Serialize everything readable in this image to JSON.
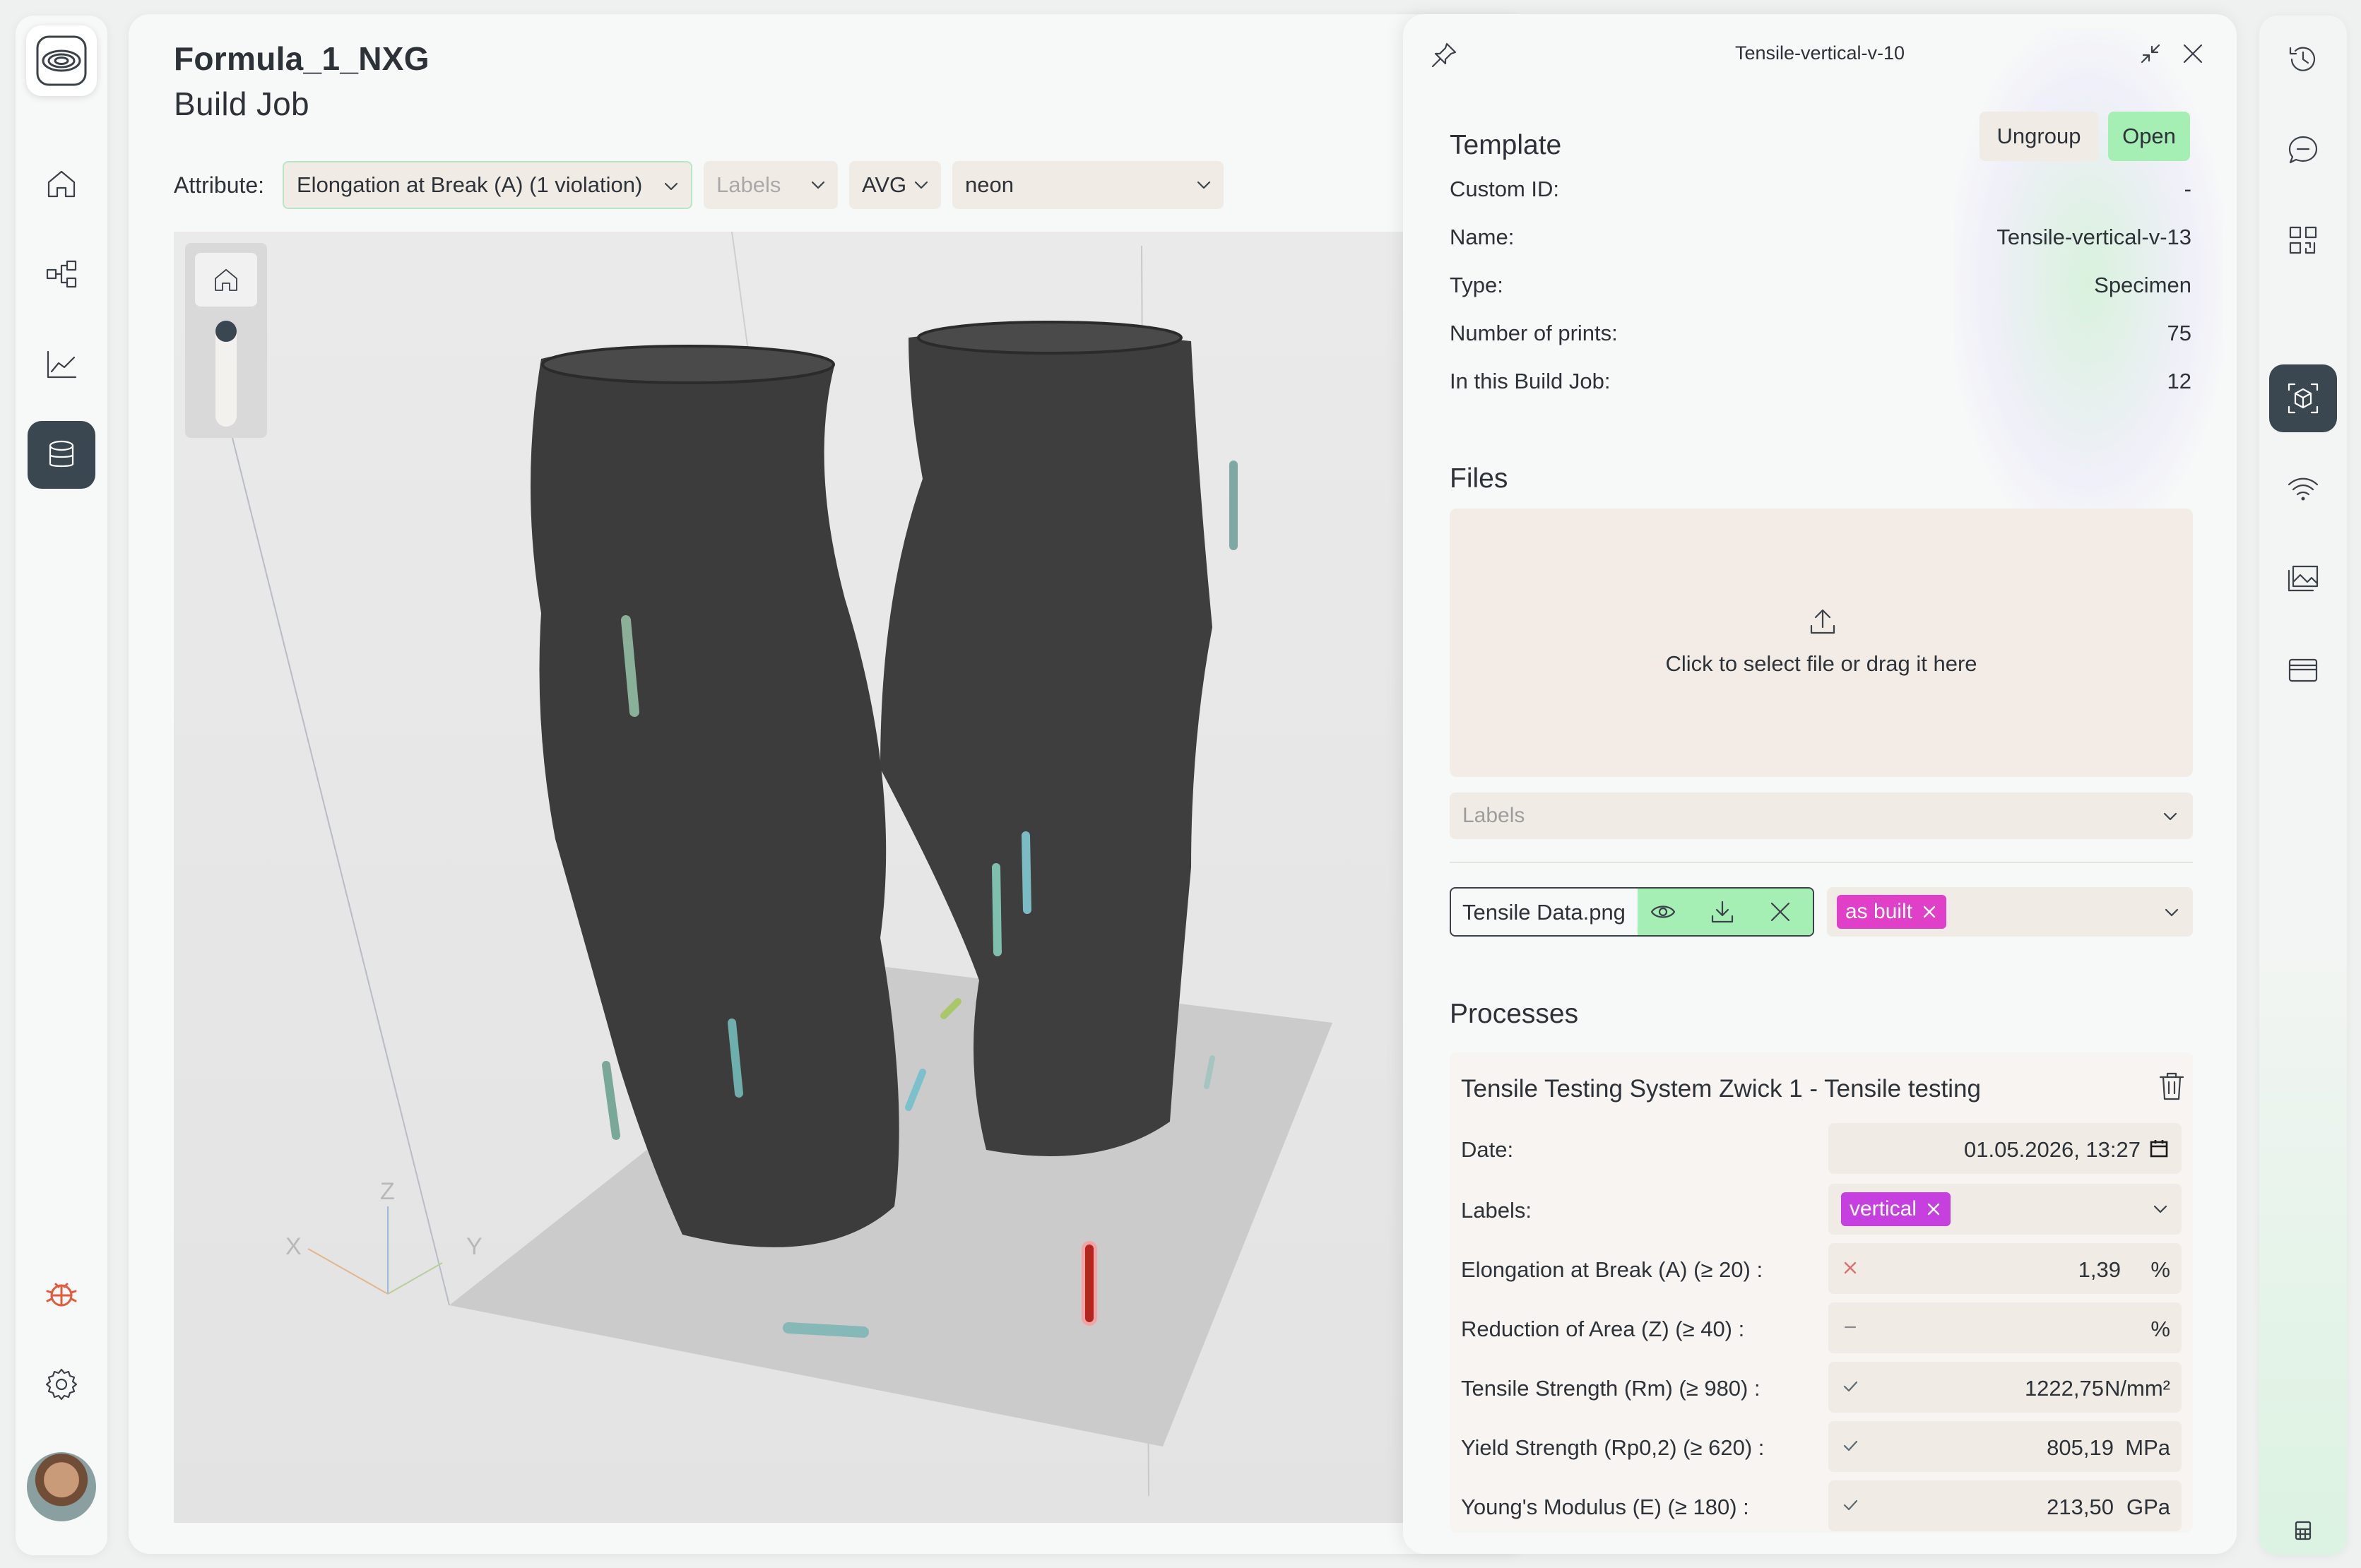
{
  "colors": {
    "accent_green": "#a5efb5",
    "tag_magenta": "#e040c8",
    "dark": "#3a4650",
    "violation_red": "#e07070",
    "field_bg": "#f1ebe5"
  },
  "left_nav": {
    "items": [
      {
        "icon": "home-icon"
      },
      {
        "icon": "workflow-icon"
      },
      {
        "icon": "chart-icon"
      },
      {
        "icon": "database-icon",
        "active": true
      }
    ],
    "bottom": [
      {
        "icon": "bug-icon"
      },
      {
        "icon": "gear-icon"
      },
      {
        "icon": "avatar"
      }
    ]
  },
  "header": {
    "title_line1": "Formula_1_NXG",
    "title_line2": "Build Job"
  },
  "toolbar": {
    "attribute_label": "Attribute:",
    "attribute_value": "Elongation at Break (A) (1 violation)",
    "labels_placeholder": "Labels",
    "aggregate_value": "AVG",
    "colormap_value": "neon"
  },
  "viewport": {
    "axes": {
      "x": "X",
      "y": "Y",
      "z": "Z"
    }
  },
  "detail": {
    "title": "Tensile-vertical-v-10",
    "template": {
      "heading": "Template",
      "ungroup_label": "Ungroup",
      "open_label": "Open",
      "fields": [
        {
          "key": "Custom ID:",
          "value": "-"
        },
        {
          "key": "Name:",
          "value": "Tensile-vertical-v-13"
        },
        {
          "key": "Type:",
          "value": "Specimen"
        },
        {
          "key": "Number of prints:",
          "value": "75"
        },
        {
          "key": "In this Build Job:",
          "value": "12"
        }
      ]
    },
    "files": {
      "heading": "Files",
      "dropzone_text": "Click to select file or drag it here",
      "labels_placeholder": "Labels",
      "file_name": "Tensile Data.png",
      "file_tag": "as built"
    },
    "processes": {
      "heading": "Processes",
      "card_title": "Tensile Testing System Zwick 1 - Tensile testing",
      "date_label": "Date:",
      "date_value": "01.05.2026, 13:27",
      "labels_label": "Labels:",
      "labels_tag": "vertical",
      "measurements": [
        {
          "label": "Elongation at Break (A)  (≥ 20) :",
          "status": "fail",
          "value": "1,39",
          "unit": "%"
        },
        {
          "label": "Reduction of Area (Z)  (≥ 40) :",
          "status": "none",
          "value": "",
          "unit": "%"
        },
        {
          "label": "Tensile Strength (Rm)  (≥ 980) :",
          "status": "pass",
          "value": "1222,75",
          "unit": "N/mm²"
        },
        {
          "label": "Yield Strength (Rp0,2)  (≥ 620) :",
          "status": "pass",
          "value": "805,19",
          "unit": "MPa"
        },
        {
          "label": "Young's Modulus (E)  (≥ 180) :",
          "status": "pass",
          "value": "213,50",
          "unit": "GPa"
        }
      ]
    }
  },
  "right_nav": {
    "items": [
      {
        "icon": "history-icon"
      },
      {
        "icon": "chat-icon"
      },
      {
        "icon": "qr-code-icon"
      },
      {
        "icon": "cube-scan-icon",
        "active": true
      },
      {
        "icon": "wifi-icon"
      },
      {
        "icon": "image-gallery-icon"
      },
      {
        "icon": "wallet-icon"
      },
      {
        "icon": "calculator-icon"
      }
    ]
  }
}
